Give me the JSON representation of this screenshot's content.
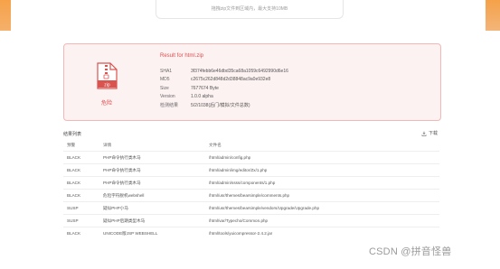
{
  "upload": {
    "hint": "拖拽zip文件到区域内，最大支持10MB"
  },
  "result": {
    "title": "Result for html.zip",
    "danger_label": "危险",
    "info": [
      {
        "label": "SHA1",
        "value": "3f374febb6e46dbd35ca68a1059c6492990d6e16"
      },
      {
        "label": "MD5",
        "value": "c2675c262d848d2d38848ac9a0e932e8"
      },
      {
        "label": "Size",
        "value": "7677674 Byte"
      },
      {
        "label": "Version",
        "value": "1.0.0 alpha"
      },
      {
        "label": "检测结果",
        "value": "5/2/1038(后门/模拟/文件总数)"
      }
    ]
  },
  "list": {
    "title": "结果列表",
    "download_label": "下载",
    "headers": [
      "预警",
      "详情",
      "文件名"
    ],
    "rows": [
      [
        "BLACK",
        "PHP命令执行类木马",
        "/html/admin/config.php"
      ],
      [
        "BLACK",
        "PHP命令执行类木马",
        "/html/admin/img/editor/Zx/1.php"
      ],
      [
        "BLACK",
        "PHP命令执行类木马",
        "/html/admin/ssss/components/1.php"
      ],
      [
        "BLACK",
        "危险字符脱机webshell",
        "/html/usr/themes/bearsimple/comments.php"
      ],
      [
        "SUSP",
        "疑似PHP小马",
        "/html/usr/themes/bearsimple/vendors/Upgrade/Upgrade.php"
      ],
      [
        "SUSP",
        "疑似PHP后期类型木马",
        "/html/var/Typecho/Common.php"
      ],
      [
        "BLACK",
        "UNICODE版JSP WEBSHELL",
        "/html/tools/yuicompressor-2.4.2.jar"
      ]
    ]
  },
  "watermark": "CSDN @拼音怪兽",
  "colors": {
    "accent_orange": "#f7a24a",
    "danger": "#e04a4a",
    "panel_bg": "#fdf2f2",
    "panel_border": "#f2b8b8"
  }
}
